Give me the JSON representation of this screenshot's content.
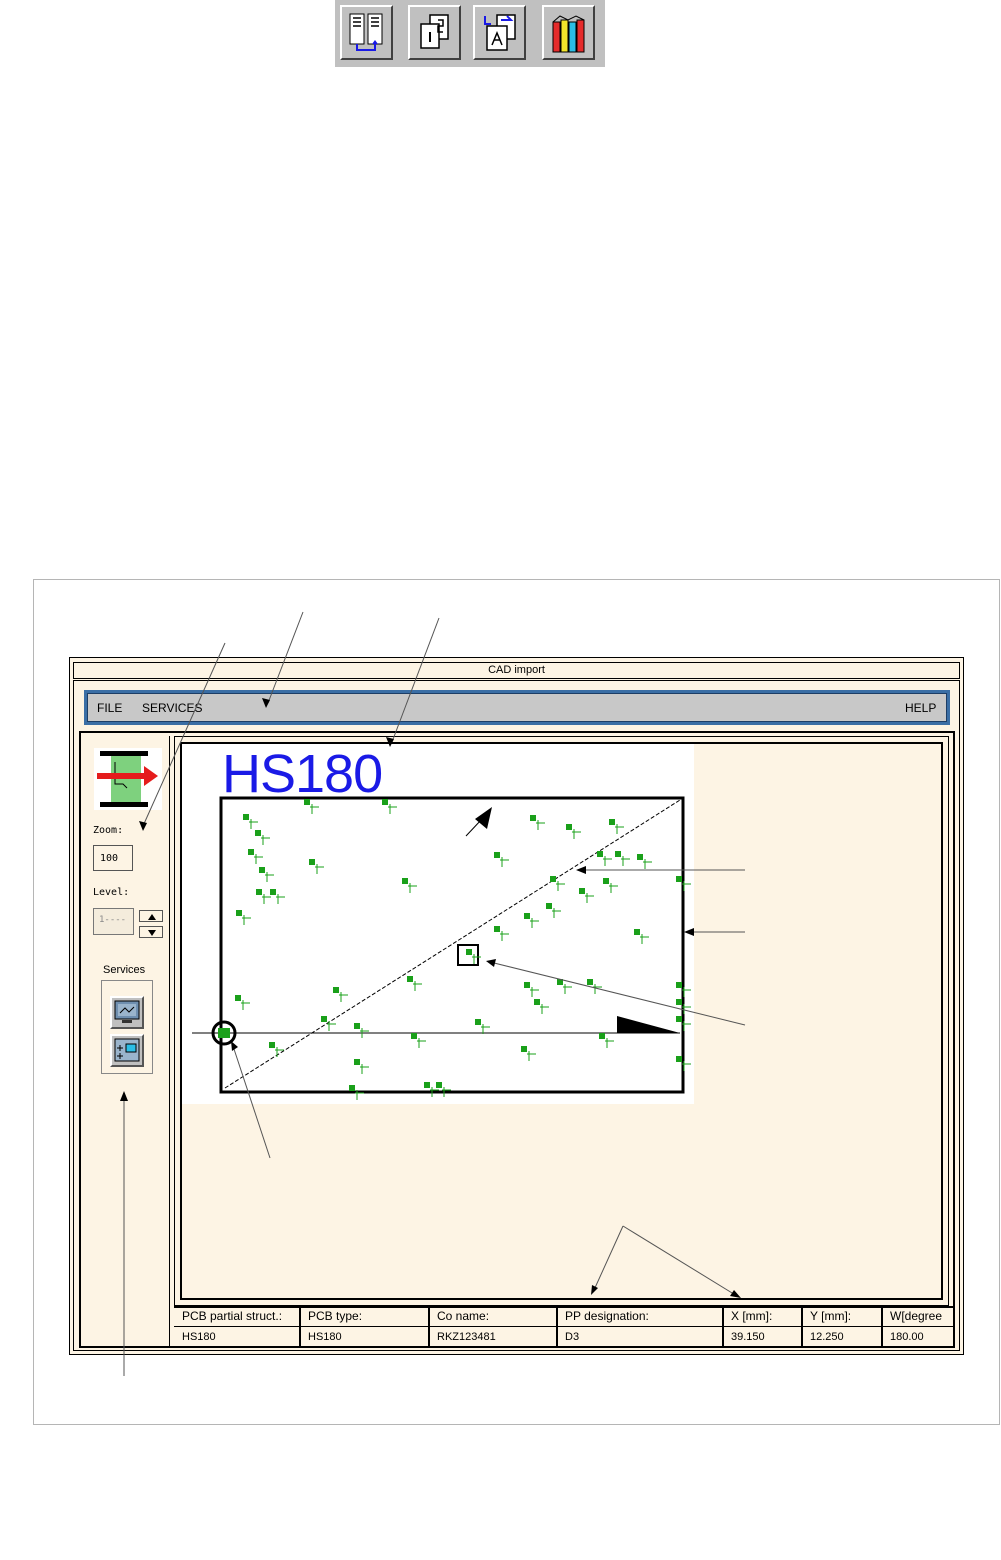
{
  "toolbar": {
    "buttons": [
      {
        "icon": "pcb-layout-transfer-icon"
      },
      {
        "icon": "pages-copy-icon"
      },
      {
        "icon": "document-import-icon"
      },
      {
        "icon": "library-books-icon"
      }
    ]
  },
  "window": {
    "title": "CAD import",
    "menu": {
      "file": "FILE",
      "services": "SERVICES",
      "help": "HELP"
    },
    "left_panel": {
      "zoom_label": "Zoom:",
      "zoom_value": "100",
      "level_label": "Level:",
      "level_value": "1----",
      "services_label": "Services",
      "service_buttons": [
        {
          "icon": "monitor-board-icon"
        },
        {
          "icon": "component-placement-icon"
        }
      ]
    },
    "canvas": {
      "board_name": "HS180",
      "accent_color": "#1a1ae6",
      "component_color": "#1aa01a"
    },
    "info_grid": {
      "headers": [
        "PCB partial struct.:",
        "PCB type:",
        "Co name:",
        "PP designation:",
        "X [mm]:",
        "Y [mm]:",
        "W[degree"
      ],
      "values": [
        "HS180",
        "HS180",
        "RKZ123481",
        "D3",
        "39.150",
        "12.250",
        "180.00"
      ]
    }
  }
}
